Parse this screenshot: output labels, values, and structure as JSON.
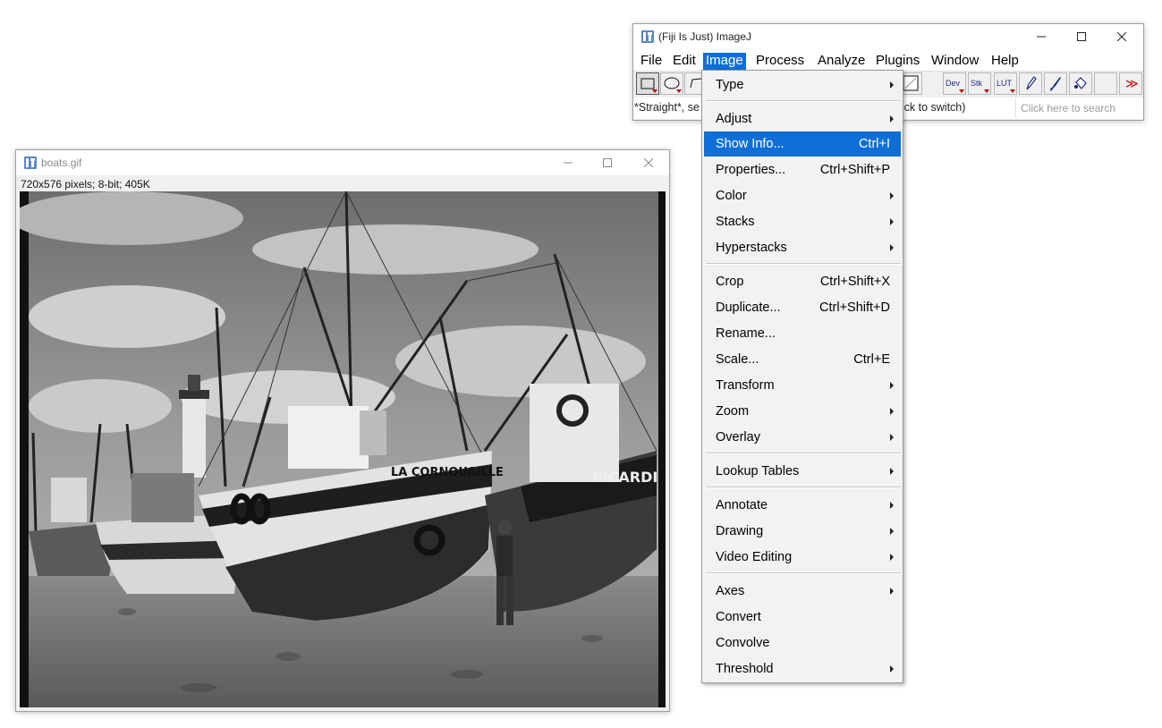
{
  "imagej": {
    "title": "(Fiji Is Just) ImageJ",
    "menus": [
      "File",
      "Edit",
      "Image",
      "Process",
      "Analyze",
      "Plugins",
      "Window",
      "Help"
    ],
    "active_menu": "Image",
    "tools": {
      "dev": "Dev",
      "stk": "Stk",
      "lut": "LUT",
      "more": "≫"
    },
    "status_left": "*Straight*, se",
    "status_right": "ght click to switch)",
    "search_placeholder": "Click here to search"
  },
  "boats": {
    "title": "boats.gif",
    "info": "720x576 pixels; 8-bit; 405K",
    "boat_name_1": "LA CORNOUAILLE",
    "boat_name_2": "PICARDIE"
  },
  "image_menu": {
    "items": [
      {
        "label": "Type",
        "shortcut": "",
        "submenu": true
      },
      {
        "label": "Adjust",
        "shortcut": "",
        "submenu": true
      },
      {
        "label": "Show Info...",
        "shortcut": "Ctrl+I",
        "submenu": false,
        "highlighted": true
      },
      {
        "label": "Properties...",
        "shortcut": "Ctrl+Shift+P",
        "submenu": false
      },
      {
        "label": "Color",
        "shortcut": "",
        "submenu": true
      },
      {
        "label": "Stacks",
        "shortcut": "",
        "submenu": true
      },
      {
        "label": "Hyperstacks",
        "shortcut": "",
        "submenu": true
      },
      {
        "label": "Crop",
        "shortcut": "Ctrl+Shift+X",
        "submenu": false
      },
      {
        "label": "Duplicate...",
        "shortcut": "Ctrl+Shift+D",
        "submenu": false
      },
      {
        "label": "Rename...",
        "shortcut": "",
        "submenu": false
      },
      {
        "label": "Scale...",
        "shortcut": "Ctrl+E",
        "submenu": false
      },
      {
        "label": "Transform",
        "shortcut": "",
        "submenu": true
      },
      {
        "label": "Zoom",
        "shortcut": "",
        "submenu": true
      },
      {
        "label": "Overlay",
        "shortcut": "",
        "submenu": true
      },
      {
        "label": "Lookup Tables",
        "shortcut": "",
        "submenu": true
      },
      {
        "label": "Annotate",
        "shortcut": "",
        "submenu": true
      },
      {
        "label": "Drawing",
        "shortcut": "",
        "submenu": true
      },
      {
        "label": "Video Editing",
        "shortcut": "",
        "submenu": true
      },
      {
        "label": "Axes",
        "shortcut": "",
        "submenu": true
      },
      {
        "label": "Convert",
        "shortcut": "",
        "submenu": false
      },
      {
        "label": "Convolve",
        "shortcut": "",
        "submenu": false
      },
      {
        "label": "Threshold",
        "shortcut": "",
        "submenu": true
      }
    ]
  },
  "colors": {
    "accent": "#0f6fd7",
    "icon": "#5b87c6"
  }
}
